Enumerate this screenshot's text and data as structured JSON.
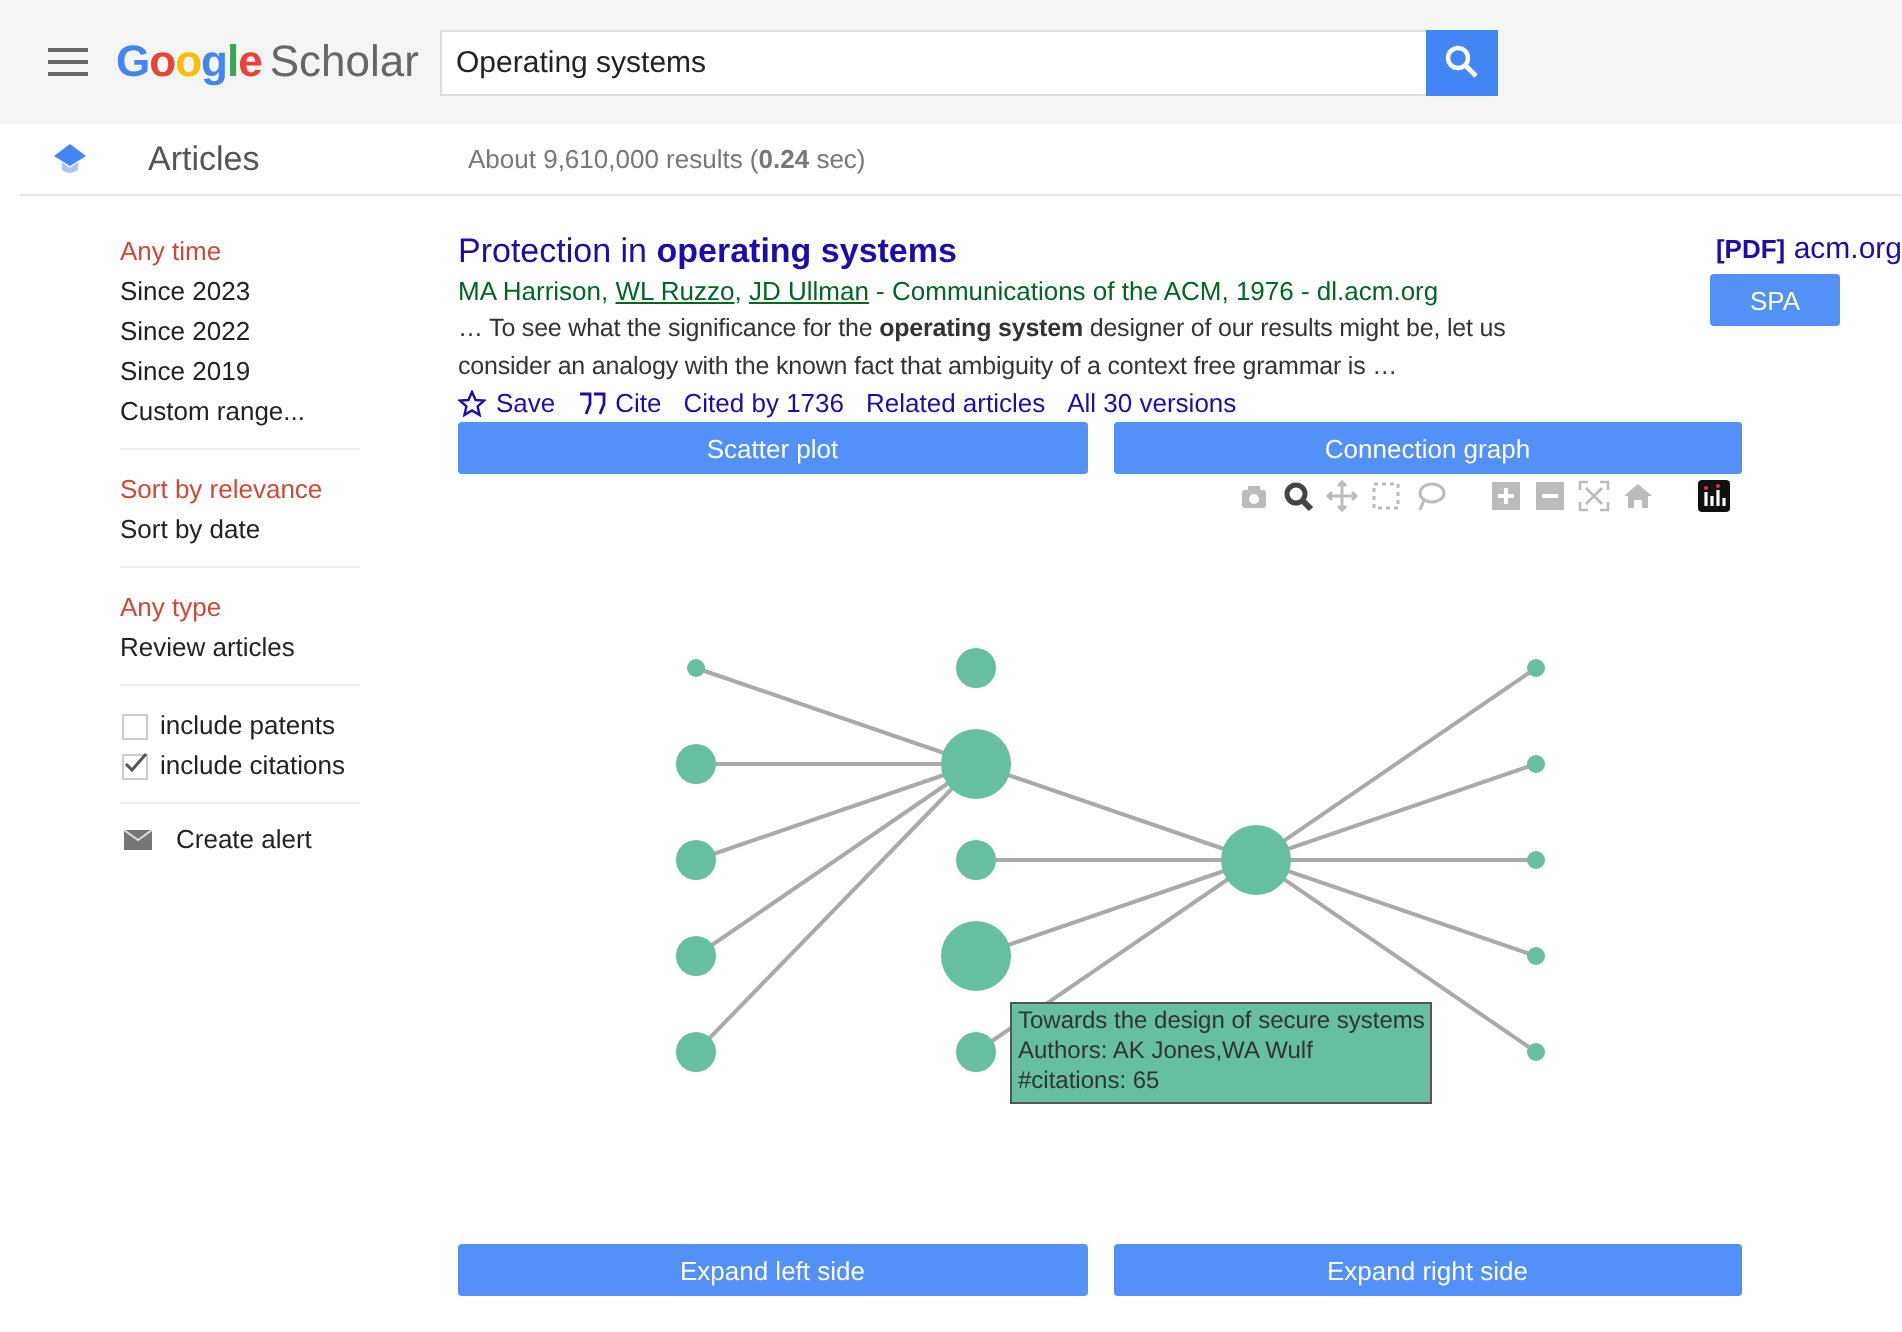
{
  "header": {
    "logo_google": "Google",
    "logo_scholar": "Scholar",
    "search": {
      "value": "Operating systems"
    }
  },
  "subheader": {
    "section": "Articles",
    "results": "About 9,610,000 results (**0.24** sec)"
  },
  "sidebar": {
    "groups": [
      {
        "items": [
          {
            "label": "Any time",
            "selected": true
          },
          {
            "label": "Since 2023",
            "selected": false
          },
          {
            "label": "Since 2022",
            "selected": false
          },
          {
            "label": "Since 2019",
            "selected": false
          },
          {
            "label": "Custom range...",
            "selected": false
          }
        ]
      },
      {
        "items": [
          {
            "label": "Sort by relevance",
            "selected": true
          },
          {
            "label": "Sort by date",
            "selected": false
          }
        ]
      },
      {
        "items": [
          {
            "label": "Any type",
            "selected": true
          },
          {
            "label": "Review articles",
            "selected": false
          }
        ]
      }
    ],
    "checkboxes": [
      {
        "label": "include patents",
        "checked": false
      },
      {
        "label": "include citations",
        "checked": true
      }
    ],
    "alert": "Create alert"
  },
  "result": {
    "title": "Protection in **operating systems**",
    "byline": [
      {
        "text": "MA Harrison, ",
        "kind": "text"
      },
      {
        "text": "WL Ruzzo",
        "kind": "link"
      },
      {
        "text": ", ",
        "kind": "text"
      },
      {
        "text": "JD Ullman",
        "kind": "link"
      },
      {
        "text": " - Communications of the ACM, 1976 - dl.acm.org",
        "kind": "text"
      }
    ],
    "snippet": "… To see what the significance for the **operating system** designer of our results might be, let us consider an analogy with the known fact that ambiguity of a context free grammar is …",
    "actions": [
      {
        "kind": "save",
        "label": "Save"
      },
      {
        "kind": "cite",
        "label": "Cite"
      },
      {
        "kind": "text",
        "label": "Cited by 1736"
      },
      {
        "kind": "text",
        "label": "Related articles"
      },
      {
        "kind": "text",
        "label": "All 30 versions"
      }
    ],
    "pdf_tag": "[PDF]",
    "pdf_site": "acm.org",
    "spa_button": "SPA"
  },
  "view_buttons": [
    "Scatter plot",
    "Connection graph"
  ],
  "toolbar": [
    {
      "kind": "camera",
      "selected": false
    },
    {
      "kind": "zoom",
      "selected": true
    },
    {
      "kind": "pan",
      "selected": false
    },
    {
      "kind": "box",
      "selected": false
    },
    {
      "kind": "lasso",
      "selected": false
    },
    {
      "kind": "zoom-in",
      "selected": false
    },
    {
      "kind": "zoom-out",
      "selected": false
    },
    {
      "kind": "autoscale",
      "selected": false
    },
    {
      "kind": "home",
      "selected": false
    }
  ],
  "graph": {
    "tooltip": {
      "title": "Towards the design of secure systems",
      "authors": "Authors: AK Jones,WA Wulf",
      "citations": "#citations: 65"
    }
  },
  "expand_buttons": [
    "Expand left side",
    "Expand right side"
  ]
}
